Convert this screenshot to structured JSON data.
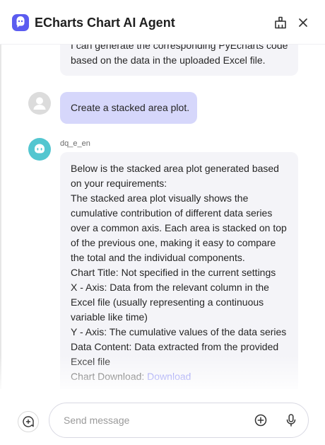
{
  "header": {
    "title": "ECharts Chart AI Agent",
    "logo_icon": "bot-logo-icon",
    "clean_icon": "broom-icon",
    "close_icon": "close-icon"
  },
  "messages": {
    "prev_bot_tail": [
      "I can generate the corresponding PyEcharts code",
      "based on the data in the uploaded Excel file."
    ],
    "user_message": "Create a stacked area plot.",
    "bot_name": "dq_e_en",
    "bot_reply_lines": [
      "Below is the stacked area plot generated based",
      "on your requirements:",
      "The stacked area plot visually shows the",
      "cumulative contribution of different data series",
      "over a common axis. Each area is stacked on top",
      "of the previous one, making it easy to compare",
      "the total and the individual components.",
      "Chart Title: Not specified in the current settings",
      "X - Axis: Data from the relevant column in the",
      "Excel file (usually representing a continuous",
      "variable like time)",
      "Y - Axis: The cumulative values of the data series",
      "Data Content: Data extracted from the provided",
      "Excel file"
    ],
    "download_label": "Chart Download: ",
    "download_link": "Download"
  },
  "composer": {
    "placeholder": "Send message",
    "new_chat_icon": "new-chat-icon",
    "attach_icon": "plus-circle-icon",
    "voice_icon": "microphone-icon"
  },
  "colors": {
    "accent": "#5b5cf0",
    "user_bubble": "#d6d7fb",
    "bot_bubble": "#f4f4f8",
    "bot_avatar": "#53c6d0",
    "link": "#6b6ff0"
  }
}
